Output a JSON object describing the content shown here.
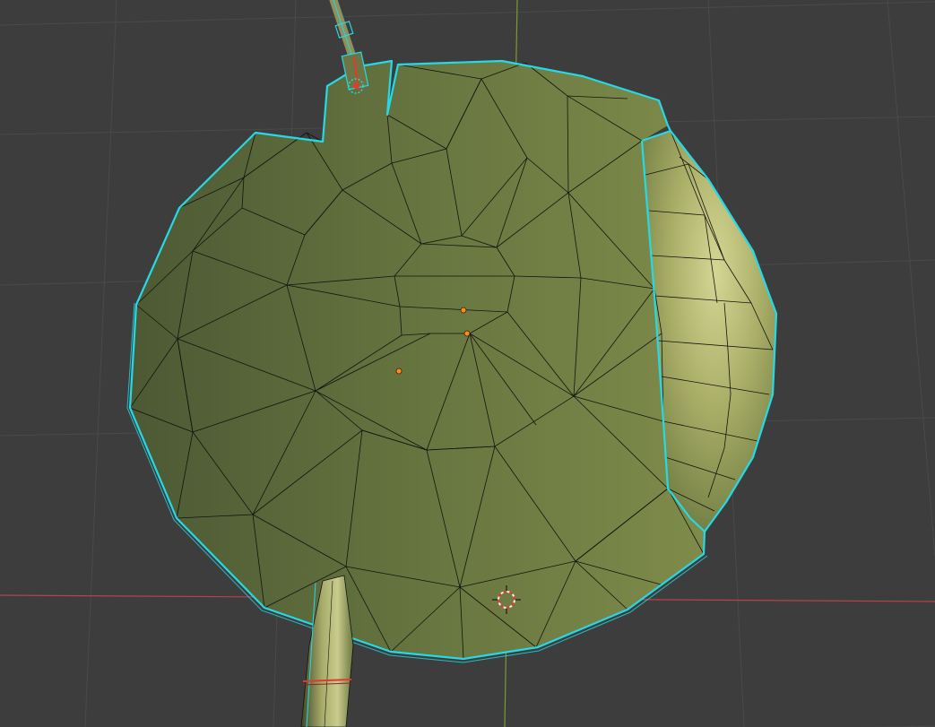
{
  "viewport": {
    "kind": "blender-3d-viewport-edit-mode",
    "icons": [
      "3d-cursor-icon",
      "origin-dot-icon"
    ]
  },
  "colors": {
    "background": "#3d3d3d",
    "grid_line": "#4b4b4b",
    "x_axis": "#b8434a",
    "y_axis": "#7b9a2e",
    "face_light": "#c6ca84",
    "face_mid": "#7e8b4a",
    "face_dark": "#4f5c36",
    "wire": "#121410",
    "selection_outline": "#25d9e6",
    "origin_dot": "#ff8a1e",
    "cursor_red": "#e23b2e",
    "cursor_white": "#f2f2f2"
  }
}
